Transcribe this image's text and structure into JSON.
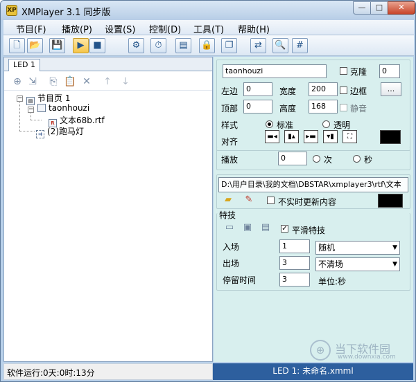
{
  "window": {
    "app_icon_text": "XP",
    "title": "XMPlayer 3.1 同步版",
    "min": "—",
    "max": "□",
    "close": "✕"
  },
  "menu": [
    "节目(F)",
    "播放(P)",
    "设置(S)",
    "控制(D)",
    "工具(T)",
    "帮助(H)"
  ],
  "toolbar": [
    {
      "name": "new-file-icon",
      "glyph": "🗋"
    },
    {
      "name": "open-folder-icon",
      "glyph": "📂"
    },
    {
      "name": "save-icon",
      "glyph": "💾"
    },
    {
      "name": "play-icon",
      "glyph": "▶"
    },
    {
      "name": "stop-icon",
      "glyph": "■"
    },
    {
      "name": "gear-icon",
      "glyph": "⚙"
    },
    {
      "name": "timer-icon",
      "glyph": "⏱"
    },
    {
      "name": "screen-icon",
      "glyph": "▤"
    },
    {
      "name": "lock-icon",
      "glyph": "🔒"
    },
    {
      "name": "windows-icon",
      "glyph": "❐"
    },
    {
      "name": "sync-icon",
      "glyph": "⇄"
    },
    {
      "name": "search-icon",
      "glyph": "🔍"
    },
    {
      "name": "grid-icon",
      "glyph": "#"
    }
  ],
  "left": {
    "tab": "LED 1",
    "tree_toolbar": [
      {
        "name": "add-node-icon",
        "glyph": "⊕",
        "dim": false
      },
      {
        "name": "insert-node-icon",
        "glyph": "⇲",
        "dim": false
      },
      {
        "name": "copy-icon",
        "glyph": "⎘",
        "dim": false
      },
      {
        "name": "paste-icon",
        "glyph": "📋",
        "dim": true
      },
      {
        "name": "delete-icon",
        "glyph": "✕",
        "dim": false
      },
      {
        "name": "move-up-icon",
        "glyph": "↑",
        "dim": true
      },
      {
        "name": "move-down-icon",
        "glyph": "↓",
        "dim": true
      }
    ],
    "tree": {
      "root_label": "节目页",
      "root_count": "1",
      "child_label": "taonhouzi",
      "file_label": "文本68b.rtf",
      "marquee_label": "(2)跑马灯"
    },
    "status": "软件运行:0天:0时:13分"
  },
  "right": {
    "name_value": "taonhouzi",
    "clone_label": "克隆",
    "clone_value": "0",
    "left_label": "左边",
    "left_value": "0",
    "width_label": "宽度",
    "width_value": "200",
    "border_label": "边框",
    "more_btn": "...",
    "top_label": "顶部",
    "top_value": "0",
    "height_label": "高度",
    "height_value": "168",
    "mute_label": "静音",
    "style_label": "样式",
    "style_standard": "标准",
    "style_transparent": "透明",
    "align_label": "对齐",
    "play_label": "播放",
    "play_value": "0",
    "times_label": "次",
    "seconds_label": "秒",
    "path_value": "D:\\用户目录\\我的文档\\DBSTAR\\xmplayer3\\rtf\\文本",
    "realtime_label": "不实时更新内容",
    "effects_title": "特技",
    "smooth_label": "平滑特技",
    "enter_label": "入场",
    "enter_value": "1",
    "enter_select": "随机",
    "exit_label": "出场",
    "exit_value": "3",
    "exit_select": "不清场",
    "stay_label": "停留时间",
    "stay_value": "3",
    "unit_label": "单位:秒",
    "bottom_status": "LED 1: 未命名.xmml"
  },
  "watermark": {
    "logo": "⊕",
    "text": "当下软件园",
    "url": "www.downxia.com"
  }
}
